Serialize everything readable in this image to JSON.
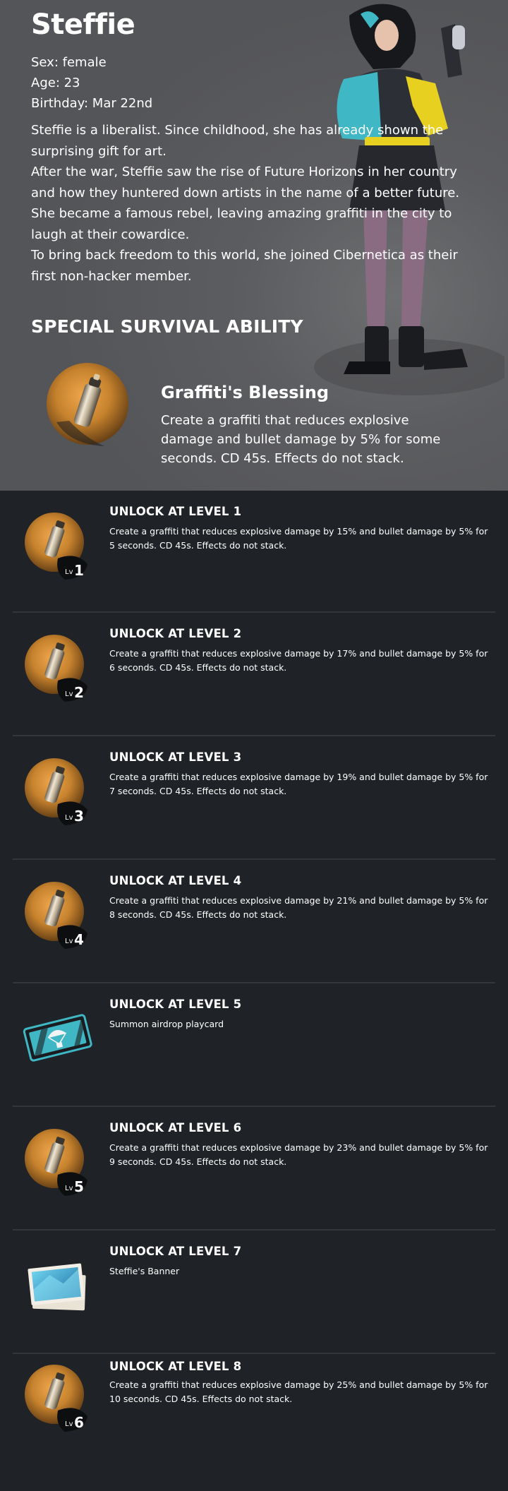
{
  "character": {
    "name": "Steffie",
    "sex": "Sex: female",
    "age": "Age: 23",
    "birthday": "Birthday: Mar 22nd",
    "bio": [
      "Steffie is a liberalist. Since childhood, she has already shown the surprising gift for art.",
      "After the war, Steffie saw the rise of Future Horizons in her country and how they huntered down artists in the name of a better future. She became a famous rebel, leaving amazing graffiti in the city to laugh at their cowardice.",
      "To bring back freedom to this world, she joined Cibernetica as their first non-hacker member."
    ]
  },
  "ability": {
    "section_title": "SPECIAL SURVIVAL ABILITY",
    "name": "Graffiti's Blessing",
    "description": "Create a graffiti that reduces explosive damage and bullet damage by 5% for some seconds. CD 45s. Effects do not stack."
  },
  "levels": [
    {
      "title": "UNLOCK AT LEVEL 1",
      "description": "Create a graffiti that reduces explosive damage by 15% and bullet damage by 5% for 5 seconds. CD 45s. Effects do not stack.",
      "icon": "spray-can-icon",
      "badge": "1"
    },
    {
      "title": "UNLOCK AT LEVEL 2",
      "description": "Create a graffiti that reduces explosive damage by 17% and bullet damage by 5% for 6 seconds. CD 45s. Effects do not stack.",
      "icon": "spray-can-icon",
      "badge": "2"
    },
    {
      "title": "UNLOCK AT LEVEL 3",
      "description": "Create a graffiti that reduces explosive damage by 19% and bullet damage by 5% for 7 seconds. CD 45s. Effects do not stack.",
      "icon": "spray-can-icon",
      "badge": "3"
    },
    {
      "title": "UNLOCK AT LEVEL 4",
      "description": "Create a graffiti that reduces explosive damage by 21% and bullet damage by 5% for 8 seconds. CD 45s. Effects do not stack.",
      "icon": "spray-can-icon",
      "badge": "4"
    },
    {
      "title": "UNLOCK AT LEVEL 5",
      "description": "Summon airdrop playcard",
      "icon": "airdrop-card-icon",
      "badge": ""
    },
    {
      "title": "UNLOCK AT LEVEL 6",
      "description": "Create a graffiti that reduces explosive damage by 23% and bullet damage by 5% for 9 seconds. CD 45s. Effects do not stack.",
      "icon": "spray-can-icon",
      "badge": "5"
    },
    {
      "title": "UNLOCK AT LEVEL 7",
      "description": "Steffie's Banner",
      "icon": "banner-icon",
      "badge": ""
    },
    {
      "title": "UNLOCK AT LEVEL 8",
      "description": "Create a graffiti that reduces explosive damage by 25% and bullet damage by 5% for 10 seconds. CD 45s. Effects do not stack.",
      "icon": "spray-can-icon",
      "badge": "6"
    }
  ],
  "level_badge_prefix": "Lv",
  "colors": {
    "hero_bg": "#5c5d60",
    "levels_bg": "#1f2226",
    "divider": "#33363b",
    "orb_orange": "#d08a34",
    "accent_teal": "#3fb7c4",
    "accent_yellow": "#e8d021"
  }
}
